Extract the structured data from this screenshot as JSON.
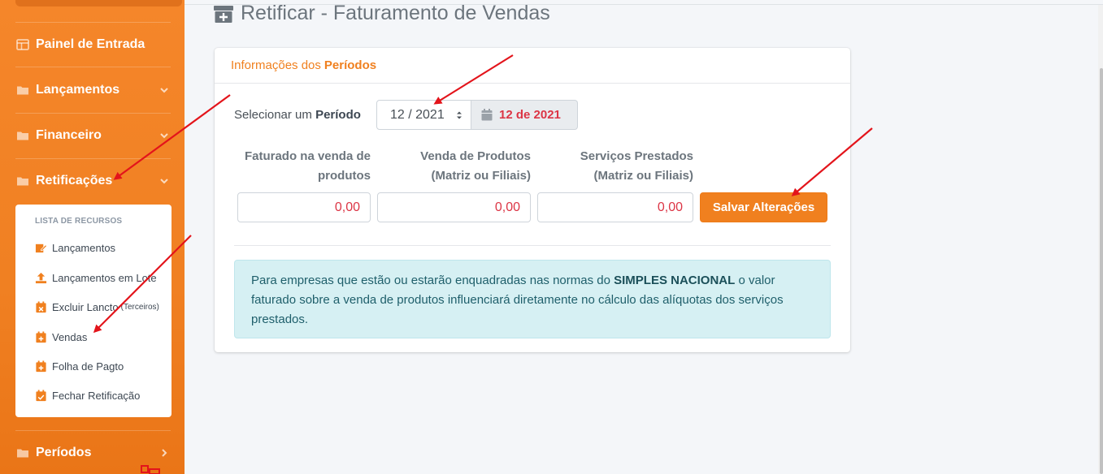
{
  "sidebar": {
    "items": [
      {
        "label": "Painel de Entrada",
        "icon": "dashboard-icon",
        "chevron": ""
      },
      {
        "label": "Lançamentos",
        "icon": "folder-icon",
        "chevron": "chevron-down-icon"
      },
      {
        "label": "Financeiro",
        "icon": "folder-icon",
        "chevron": "chevron-down-icon"
      },
      {
        "label": "Retificações",
        "icon": "folder-icon",
        "chevron": "chevron-down-icon"
      },
      {
        "label": "Períodos",
        "icon": "folder-icon",
        "chevron": "chevron-right-icon"
      }
    ],
    "submenu": {
      "header": "LISTA DE RECURSOS",
      "items": [
        {
          "label": "Lançamentos",
          "suffix": "",
          "icon": "edit-icon"
        },
        {
          "label": "Lançamentos em Lote",
          "suffix": "",
          "icon": "upload-icon"
        },
        {
          "label": "Excluir Lancto",
          "suffix": "(Terceiros)",
          "icon": "calendar-x-icon"
        },
        {
          "label": "Vendas",
          "suffix": "",
          "icon": "calendar-plus-icon"
        },
        {
          "label": "Folha de Pagto",
          "suffix": "",
          "icon": "calendar-plus-icon"
        },
        {
          "label": "Fechar Retificação",
          "suffix": "",
          "icon": "calendar-check-icon"
        }
      ]
    }
  },
  "page": {
    "title": "Retificar - Faturamento de Vendas",
    "title_icon": "archive-plus-icon"
  },
  "card": {
    "header_prefix": "Informações dos",
    "header_bold": "Períodos",
    "period": {
      "label_prefix": "Selecionar um",
      "label_bold": "Período",
      "selected": "12 / 2021",
      "display": "12 de 2021"
    },
    "fields": [
      {
        "label_line1": "Faturado na venda de",
        "label_line2": "produtos",
        "value": "0,00"
      },
      {
        "label_line1": "Venda de Produtos",
        "label_line2": "(Matriz ou Filiais)",
        "value": "0,00"
      },
      {
        "label_line1": "Serviços Prestados",
        "label_line2": "(Matriz ou Filiais)",
        "value": "0,00"
      }
    ],
    "save_label": "Salvar Alterações",
    "info": {
      "text_before": "Para empresas que estão ou estarão enquadradas nas normas do ",
      "bold": "SIMPLES NACIONAL",
      "text_after": " o valor faturado sobre a venda de produtos influenciará diretamente no cálculo das alíquotas dos serviços prestados."
    }
  },
  "colors": {
    "brand_orange": "#f0801f",
    "danger_red": "#dc3545",
    "info_bg": "#d6f0f3",
    "annotation_red": "#e3141b"
  }
}
